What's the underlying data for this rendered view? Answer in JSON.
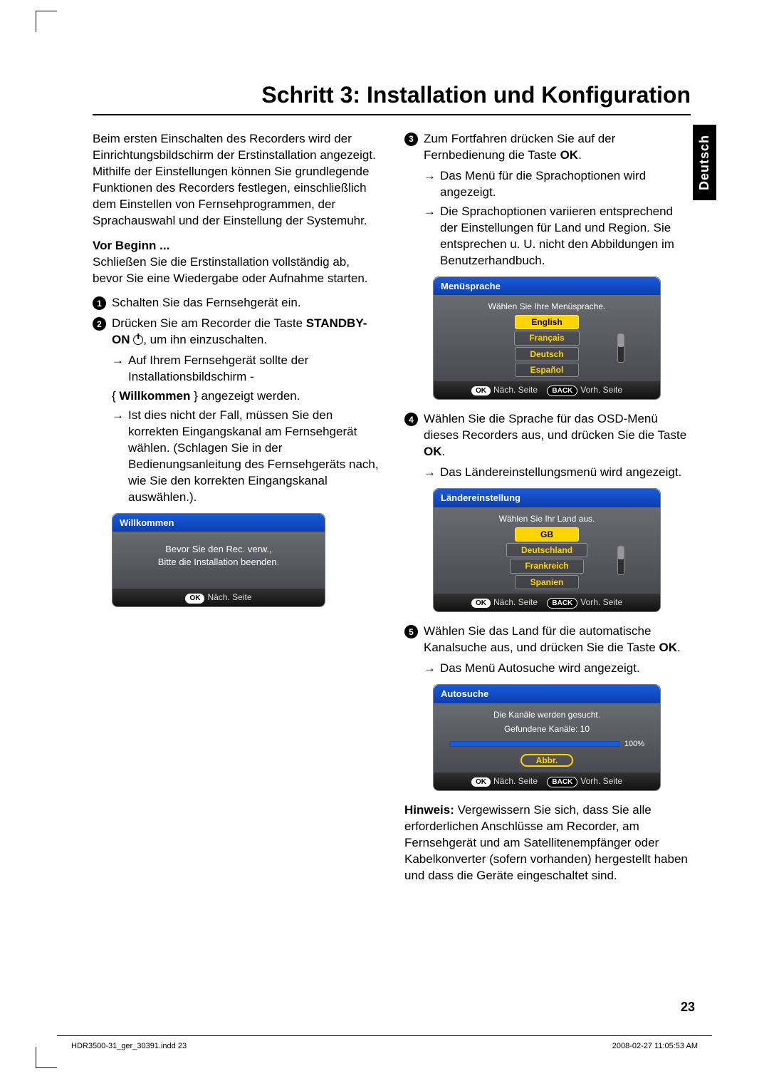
{
  "title": "Schritt 3: Installation und Konfiguration",
  "langTab": "Deutsch",
  "intro": "Beim ersten Einschalten des Recorders wird der Einrichtungsbildschirm der Erstinstallation angezeigt. Mithilfe der Einstellungen können Sie grundlegende Funktionen des Recorders festlegen, einschließlich dem Einstellen von Fernsehprogrammen, der Sprachauswahl und der Einstellung der Systemuhr.",
  "vorBeginnLabel": "Vor Beginn ...",
  "vorBeginnText": "Schließen Sie die Erstinstallation vollständig ab, bevor Sie eine Wiedergabe oder Aufnahme starten.",
  "step1": "Schalten Sie das Fernsehgerät ein.",
  "step2a": "Drücken Sie am Recorder die Taste ",
  "step2b": "STANDBY-ON",
  "step2c": ", um ihn einzuschalten.",
  "step2arrow1": "Auf Ihrem Fernsehgerät sollte der Installationsbildschirm -",
  "step2brace_pre": "{ ",
  "step2brace_bold": "Willkommen",
  "step2brace_post": " } angezeigt werden.",
  "step2arrow2": "Ist dies nicht der Fall, müssen Sie den korrekten Eingangskanal am Fernsehgerät wählen. (Schlagen Sie in der Bedienungsanleitung des Fernsehgeräts nach, wie Sie den korrekten Eingangskanal auswählen.).",
  "osd1": {
    "title": "Willkommen",
    "line1": "Bevor Sie den Rec. verw.,",
    "line2": "Bitte die Installation beenden.",
    "okPill": "OK",
    "okLabel": "Näch. Seite"
  },
  "step3a": "Zum Fortfahren drücken Sie auf der Fernbedienung die Taste ",
  "step3b": "OK",
  "step3c": ".",
  "step3arrow1": "Das Menü für die Sprachoptionen wird angezeigt.",
  "step3arrow2": "Die Sprachoptionen variieren entsprechend der Einstellungen für Land und Region. Sie entsprechen u. U. nicht den Abbildungen im Benutzerhandbuch.",
  "osd2": {
    "title": "Menüsprache",
    "sub": "Wählen Sie Ihre Menüsprache.",
    "opts": [
      "English",
      "Français",
      "Deutsch",
      "Español"
    ],
    "okPill": "OK",
    "okLabel": "Näch. Seite",
    "backPill": "BACK",
    "backLabel": "Vorh. Seite"
  },
  "step4a": "Wählen Sie die Sprache für das OSD-Menü dieses Recorders aus, und drücken Sie die Taste ",
  "step4b": "OK",
  "step4c": ".",
  "step4arrow": "Das Ländereinstellungsmenü wird angezeigt.",
  "osd3": {
    "title": "Ländereinstellung",
    "sub": "Wählen Sie Ihr Land aus.",
    "opts": [
      "GB",
      "Deutschland",
      "Frankreich",
      "Spanien"
    ],
    "okPill": "OK",
    "okLabel": "Näch. Seite",
    "backPill": "BACK",
    "backLabel": "Vorh. Seite"
  },
  "step5a": "Wählen Sie das Land für die automatische Kanalsuche aus, und drücken Sie die Taste ",
  "step5b": "OK",
  "step5c": ".",
  "step5arrow": "Das Menü Autosuche wird angezeigt.",
  "osd4": {
    "title": "Autosuche",
    "line1": "Die Kanäle werden gesucht.",
    "line2": "Gefundene Kanäle: 10",
    "pct": "100%",
    "abbr": "Abbr.",
    "okPill": "OK",
    "okLabel": "Näch. Seite",
    "backPill": "BACK",
    "backLabel": "Vorh. Seite"
  },
  "hinweisLabel": "Hinweis:",
  "hinweisText": " Vergewissern Sie sich, dass Sie alle erforderlichen Anschlüsse am Recorder, am Fernsehgerät und am Satellitenempfänger oder Kabelkonverter (sofern vorhanden) hergestellt haben und dass die Geräte eingeschaltet sind.",
  "pageNum": "23",
  "footerLeft": "HDR3500-31_ger_30391.indd   23",
  "footerRight": "2008-02-27   11:05:53 AM"
}
